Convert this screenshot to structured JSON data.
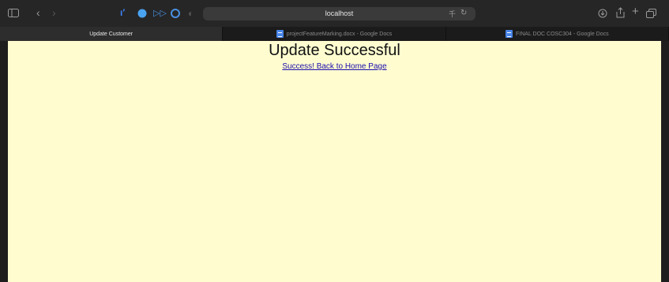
{
  "browser": {
    "address": "localhost",
    "tabs": [
      {
        "label": "Update Customer",
        "active": true,
        "doc_icon": false
      },
      {
        "label": "projectFeatureMarking.docx - Google Docs",
        "active": false,
        "doc_icon": true
      },
      {
        "label": "FINAL DOC COSC304 - Google Docs",
        "active": false,
        "doc_icon": true
      }
    ]
  },
  "page": {
    "title": "Update Successful",
    "link": "Success! Back to Home Page",
    "background": "#fffdd0"
  }
}
